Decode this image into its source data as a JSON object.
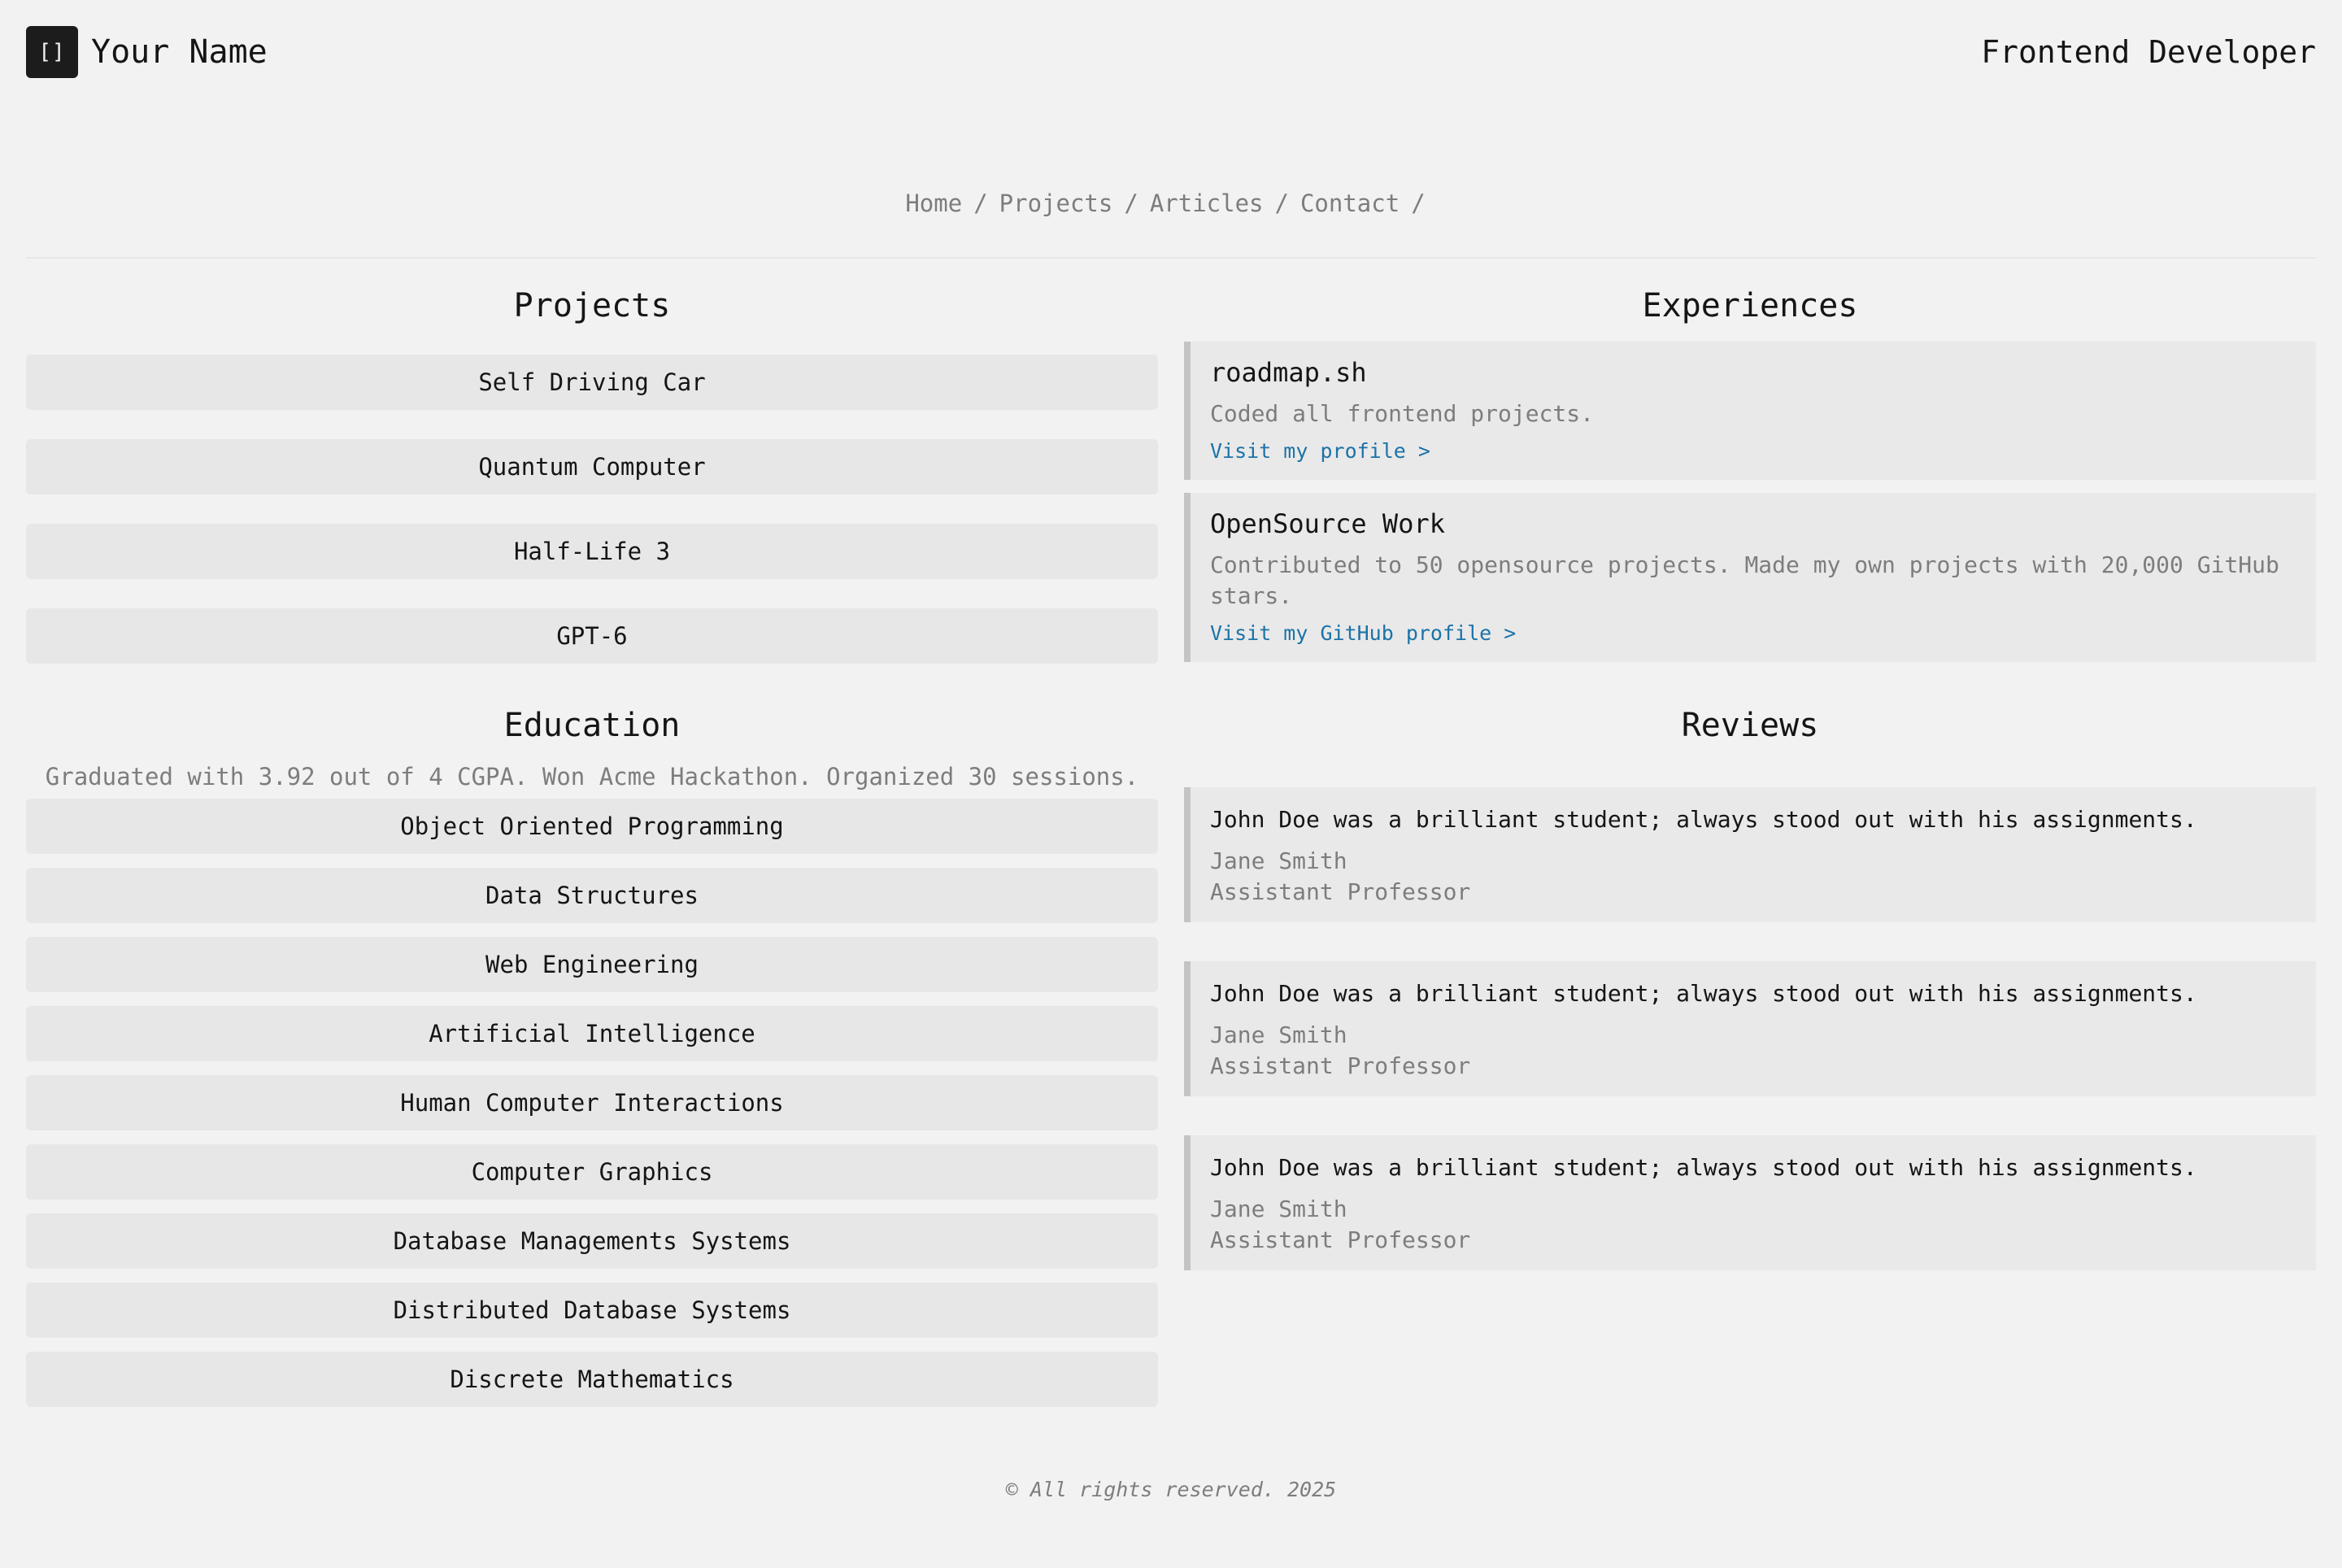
{
  "header": {
    "logo_text": "[]",
    "site_name": "Your Name",
    "role": "Frontend Developer"
  },
  "nav": {
    "items": [
      "Home",
      "Projects",
      "Articles",
      "Contact"
    ],
    "separator": "/"
  },
  "projects": {
    "title": "Projects",
    "items": [
      "Self Driving Car",
      "Quantum Computer",
      "Half-Life 3",
      "GPT-6"
    ]
  },
  "education": {
    "title": "Education",
    "description": "Graduated with 3.92 out of 4 CGPA. Won Acme Hackathon. Organized 30 sessions.",
    "courses": [
      "Object Oriented Programming",
      "Data Structures",
      "Web Engineering",
      "Artificial Intelligence",
      "Human Computer Interactions",
      "Computer Graphics",
      "Database Managements Systems",
      "Distributed Database Systems",
      "Discrete Mathematics"
    ]
  },
  "experiences": {
    "title": "Experiences",
    "items": [
      {
        "title": "roadmap.sh",
        "description": "Coded all frontend projects.",
        "link": "Visit my profile >"
      },
      {
        "title": "OpenSource Work",
        "description": "Contributed to 50 opensource projects. Made my own projects with 20,000 GitHub stars.",
        "link": "Visit my GitHub profile >"
      }
    ]
  },
  "reviews": {
    "title": "Reviews",
    "items": [
      {
        "quote": "John Doe was a brilliant student; always stood out with his assignments.",
        "name": "Jane Smith",
        "position": "Assistant Professor"
      },
      {
        "quote": "John Doe was a brilliant student; always stood out with his assignments.",
        "name": "Jane Smith",
        "position": "Assistant Professor"
      },
      {
        "quote": "John Doe was a brilliant student; always stood out with his assignments.",
        "name": "Jane Smith",
        "position": "Assistant Professor"
      }
    ]
  },
  "footer": {
    "text": "© All rights reserved. 2025"
  },
  "colors": {
    "background": "#f2f2f2",
    "card": "#e7e7e7",
    "card_border": "#c4c4c4",
    "muted_text": "#7d7d7d",
    "link": "#1b73a8",
    "logo_bg": "#1c1c1c"
  }
}
